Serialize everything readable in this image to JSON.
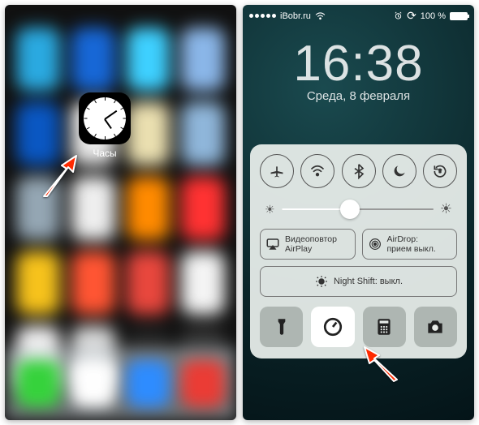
{
  "left": {
    "app_label": "Часы"
  },
  "right": {
    "status": {
      "carrier": "iBobr.ru",
      "battery_pct": "100 %"
    },
    "lock": {
      "time": "16:38",
      "date": "Среда, 8 февраля"
    },
    "cc": {
      "toggles": [
        "airplane-icon",
        "wifi-icon",
        "bluetooth-icon",
        "dnd-moon-icon",
        "rotation-lock-icon"
      ],
      "airplay_label": "Видеоповтор AirPlay",
      "airdrop_line1": "AirDrop:",
      "airdrop_line2": "прием выкл.",
      "nightshift_label": "Night Shift: выкл.",
      "quick": [
        "flashlight-icon",
        "timer-icon",
        "calculator-icon",
        "camera-icon"
      ]
    }
  }
}
